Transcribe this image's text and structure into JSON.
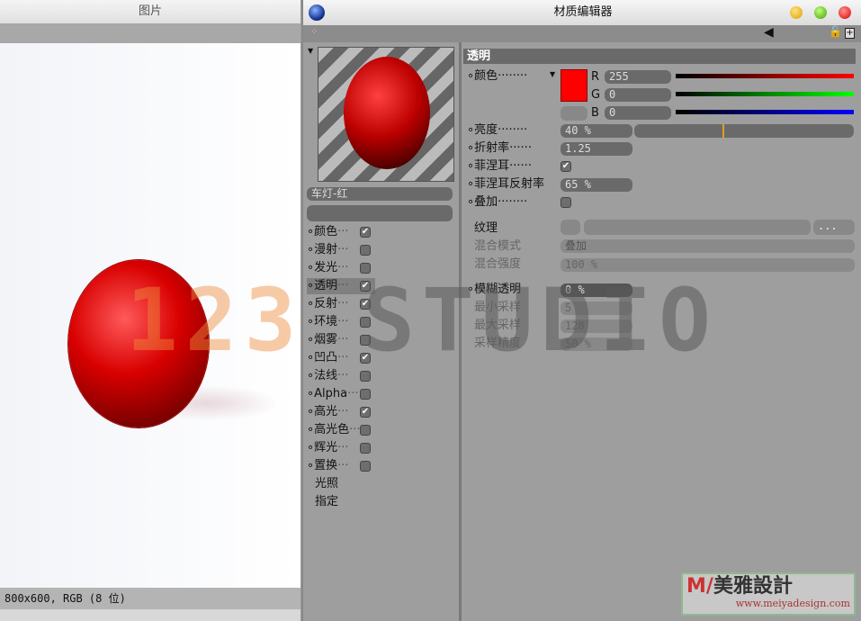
{
  "image_viewer": {
    "title": "图片",
    "status": "800x600, RGB (8 位)"
  },
  "editor": {
    "title": "材质编辑器",
    "material_name": "车灯-红",
    "channels": [
      {
        "label": "颜色",
        "checked": true
      },
      {
        "label": "漫射",
        "checked": false
      },
      {
        "label": "发光",
        "checked": false
      },
      {
        "label": "透明",
        "checked": true,
        "selected": true
      },
      {
        "label": "反射",
        "checked": true
      },
      {
        "label": "环境",
        "checked": false
      },
      {
        "label": "烟雾",
        "checked": false
      },
      {
        "label": "凹凸",
        "checked": true
      },
      {
        "label": "法线",
        "checked": false
      },
      {
        "label": "Alpha",
        "checked": false
      },
      {
        "label": "高光",
        "checked": true
      },
      {
        "label": "高光色",
        "checked": false
      },
      {
        "label": "辉光",
        "checked": false
      },
      {
        "label": "置换",
        "checked": false
      }
    ],
    "extra": [
      "光照",
      "指定"
    ],
    "section": "透明",
    "color": {
      "label": "颜色",
      "swatch": "#ff0000",
      "r_label": "R",
      "r": "255",
      "g_label": "G",
      "g": "0",
      "b_label": "B",
      "b": "0"
    },
    "brightness": {
      "label": "亮度",
      "value": "40 %",
      "fraction": 0.4
    },
    "refraction": {
      "label": "折射率",
      "value": "1.25"
    },
    "fresnel": {
      "label": "菲涅耳",
      "checked": true
    },
    "fresnel_reflect": {
      "label": "菲涅耳反射率",
      "value": "65 %"
    },
    "additive": {
      "label": "叠加",
      "checked": false
    },
    "texture": {
      "label": "纹理",
      "browse": "...",
      "blend_mode_label": "混合模式",
      "blend_mode": "叠加",
      "blend_strength_label": "混合强度",
      "blend_strength": "100 %"
    },
    "blur": {
      "label": "模糊透明",
      "value": "0 %",
      "min_label": "最小采样",
      "min": "5",
      "max_label": "最大采样",
      "max": "128",
      "acc_label": "采样精度",
      "acc": "50 %"
    }
  },
  "watermark": {
    "text_a": "123",
    "text_b": "STUDIO"
  },
  "brand": {
    "name": "美雅設計",
    "url": "www.meiyadesign.com"
  }
}
